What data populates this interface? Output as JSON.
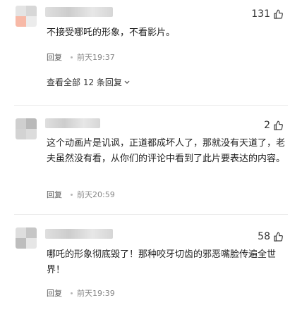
{
  "comments": [
    {
      "likes": "131",
      "text": "不接受哪吒的形象，不看影片。",
      "reply_label": "回复",
      "time": "前天19:37",
      "view_all": "查看全部 12 条回复"
    },
    {
      "likes": "2",
      "text": "这个动画片是讥讽，正道都成坏人了，那就没有天道了，老夫虽然没有看，从你们的评论中看到了此片要表达的内容。",
      "reply_label": "回复",
      "time": "前天20:59"
    },
    {
      "likes": "58",
      "text": "哪吒的形象彻底毁了！那种咬牙切齿的邪恶嘴脸传遍全世界！",
      "reply_label": "回复",
      "time": "前天19:39"
    }
  ],
  "icons": {
    "like": "thumbs-up-icon",
    "expand": "chevron-down-icon"
  },
  "colors": {
    "text": "#222222",
    "meta": "#888888",
    "divider": "#ececec"
  }
}
